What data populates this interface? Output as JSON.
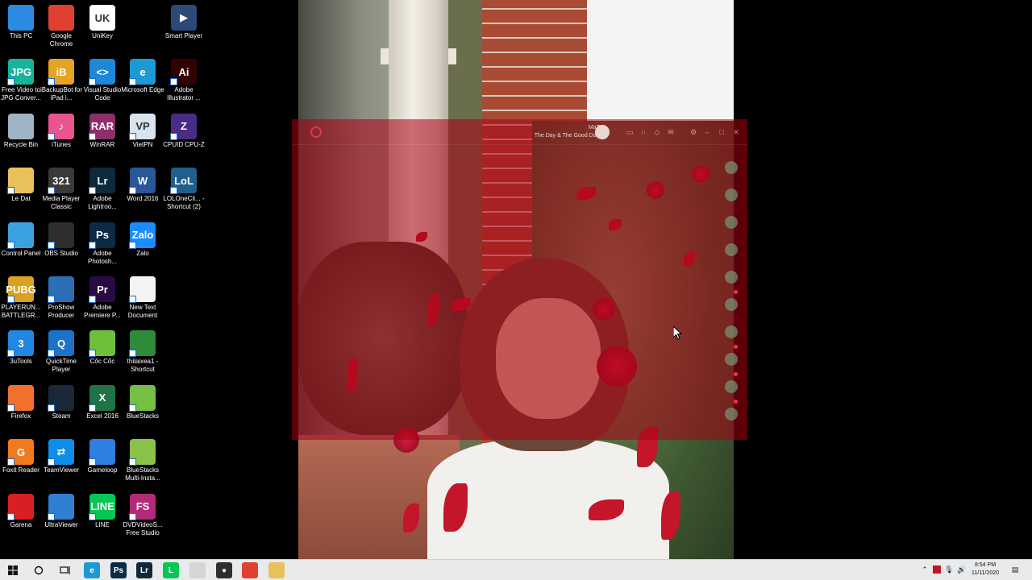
{
  "desktop_icons": [
    {
      "id": "this-pc",
      "label": "This PC",
      "glyph": "",
      "color": "#2a8be0",
      "icon": "computer-icon"
    },
    {
      "id": "chrome",
      "label": "Google Chrome",
      "glyph": "",
      "color": "#e0412f",
      "icon": "chrome-icon"
    },
    {
      "id": "unikey",
      "label": "UniKey",
      "glyph": "UK",
      "color": "#ffffff",
      "icon": "unikey-icon"
    },
    {
      "id": "smart-player",
      "label": "Smart Player",
      "glyph": "▶",
      "color": "#2c4a78",
      "icon": "player-icon"
    },
    {
      "id": "free-video",
      "label": "Free Video to JPG Conver...",
      "glyph": "JPG",
      "color": "#18b39a",
      "icon": "video-converter-icon"
    },
    {
      "id": "ibackupbot",
      "label": "iBackupBot for iPad i...",
      "glyph": "iB",
      "color": "#e5a421",
      "icon": "backup-icon"
    },
    {
      "id": "vscode",
      "label": "Visual Studio Code",
      "glyph": "<>",
      "color": "#1e88d8",
      "icon": "vscode-icon"
    },
    {
      "id": "edge",
      "label": "Microsoft Edge",
      "glyph": "e",
      "color": "#1b9ad6",
      "icon": "edge-icon"
    },
    {
      "id": "illustrator",
      "label": "Adobe Illustrator ...",
      "glyph": "Ai",
      "color": "#330000",
      "icon": "illustrator-icon"
    },
    {
      "id": "recycle",
      "label": "Recycle Bin",
      "glyph": "",
      "color": "#9fb3c4",
      "icon": "recycle-bin-icon"
    },
    {
      "id": "itunes",
      "label": "iTunes",
      "glyph": "♪",
      "color": "#e9548e",
      "icon": "itunes-icon"
    },
    {
      "id": "winrar",
      "label": "WinRAR",
      "glyph": "RAR",
      "color": "#8e2e6a",
      "icon": "winrar-icon"
    },
    {
      "id": "vietpn",
      "label": "VietPN",
      "glyph": "VP",
      "color": "#d9e4ee",
      "icon": "vpn-icon"
    },
    {
      "id": "cpuz",
      "label": "CPUID CPU-Z",
      "glyph": "Z",
      "color": "#4a2c87",
      "icon": "cpuz-icon"
    },
    {
      "id": "ledat",
      "label": "Le Dat",
      "glyph": "",
      "color": "#e8c15a",
      "icon": "folder-icon"
    },
    {
      "id": "mpc",
      "label": "Media Player Classic",
      "glyph": "321",
      "color": "#3a3a3a",
      "icon": "media-player-icon"
    },
    {
      "id": "lightroom",
      "label": "Adobe Lightroo...",
      "glyph": "Lr",
      "color": "#0c2a3c",
      "icon": "lightroom-icon"
    },
    {
      "id": "word",
      "label": "Word 2016",
      "glyph": "W",
      "color": "#2b579a",
      "icon": "word-icon"
    },
    {
      "id": "lolone",
      "label": "LOLOneCli... - Shortcut (2)",
      "glyph": "LoL",
      "color": "#1f5f8c",
      "icon": "lol-icon"
    },
    {
      "id": "control-panel",
      "label": "Control Panel",
      "glyph": "",
      "color": "#3ba2e0",
      "icon": "control-panel-icon"
    },
    {
      "id": "obs",
      "label": "OBS Studio",
      "glyph": "",
      "color": "#2e2e2e",
      "icon": "obs-icon"
    },
    {
      "id": "photoshop",
      "label": "Adobe Photosh...",
      "glyph": "Ps",
      "color": "#0b2a45",
      "icon": "photoshop-icon"
    },
    {
      "id": "zalo",
      "label": "Zalo",
      "glyph": "Zalo",
      "color": "#1a8cff",
      "icon": "zalo-icon"
    },
    {
      "id": "pubg",
      "label": "PLAYERUN... BATTLEGR...",
      "glyph": "PUBG",
      "color": "#d9a321",
      "icon": "pubg-icon"
    },
    {
      "id": "proshow",
      "label": "ProShow Producer",
      "glyph": "",
      "color": "#2b6fb6",
      "icon": "proshow-icon"
    },
    {
      "id": "premiere",
      "label": "Adobe Premiere P...",
      "glyph": "Pr",
      "color": "#2a0a45",
      "icon": "premiere-icon"
    },
    {
      "id": "new-text",
      "label": "New Text Document",
      "glyph": "",
      "color": "#f4f4f4",
      "icon": "text-document-icon"
    },
    {
      "id": "3utools",
      "label": "3uTools",
      "glyph": "3",
      "color": "#2088e0",
      "icon": "3utools-icon"
    },
    {
      "id": "quicktime",
      "label": "QuickTime Player",
      "glyph": "Q",
      "color": "#1a73c8",
      "icon": "quicktime-icon"
    },
    {
      "id": "coccoc",
      "label": "Cốc Cốc",
      "glyph": "",
      "color": "#6fbf3a",
      "icon": "coccoc-icon"
    },
    {
      "id": "thilaixe",
      "label": "thilaixea1 - Shortcut",
      "glyph": "",
      "color": "#2f8a3a",
      "icon": "traffic-light-icon"
    },
    {
      "id": "firefox",
      "label": "Firefox",
      "glyph": "",
      "color": "#f2702c",
      "icon": "firefox-icon"
    },
    {
      "id": "steam",
      "label": "Steam",
      "glyph": "",
      "color": "#1b2838",
      "icon": "steam-icon"
    },
    {
      "id": "excel",
      "label": "Excel 2016",
      "glyph": "X",
      "color": "#217346",
      "icon": "excel-icon"
    },
    {
      "id": "bluestacks",
      "label": "BlueStacks",
      "glyph": "",
      "color": "#75c043",
      "icon": "bluestacks-icon"
    },
    {
      "id": "foxit",
      "label": "Foxit Reader",
      "glyph": "G",
      "color": "#f07a1e",
      "icon": "foxit-icon"
    },
    {
      "id": "teamviewer",
      "label": "TeamViewer",
      "glyph": "⇄",
      "color": "#0e8ee9",
      "icon": "teamviewer-icon"
    },
    {
      "id": "gameloop",
      "label": "Gameloop",
      "glyph": "",
      "color": "#2f7fe0",
      "icon": "gameloop-icon"
    },
    {
      "id": "bluestacks-multi",
      "label": "BlueStacks Multi-Insta...",
      "glyph": "",
      "color": "#8bc34a",
      "icon": "bluestacks-multi-icon"
    },
    {
      "id": "garena",
      "label": "Garena",
      "glyph": "",
      "color": "#d81f26",
      "icon": "garena-icon"
    },
    {
      "id": "ultraviewer",
      "label": "UltraViewer",
      "glyph": "",
      "color": "#2f7fd3",
      "icon": "ultraviewer-icon"
    },
    {
      "id": "line",
      "label": "LINE",
      "glyph": "LINE",
      "color": "#06c755",
      "icon": "line-icon"
    },
    {
      "id": "dvdvideosoft",
      "label": "DVDVideoS... Free Studio",
      "glyph": "FS",
      "color": "#b42a7a",
      "icon": "dvdvideosoft-icon"
    }
  ],
  "app_window": {
    "user_name": "MaTa",
    "user_status": "The Day & The Good Day !"
  },
  "taskbar": {
    "apps": [
      {
        "name": "edge",
        "glyph": "e",
        "color": "#1b9ad6",
        "icon": "edge-icon"
      },
      {
        "name": "photoshop",
        "glyph": "Ps",
        "color": "#0b2a45",
        "icon": "photoshop-icon"
      },
      {
        "name": "lightroom",
        "glyph": "Lr",
        "color": "#0c2a3c",
        "icon": "lightroom-icon"
      },
      {
        "name": "line",
        "glyph": "L",
        "color": "#06c755",
        "icon": "line-icon"
      },
      {
        "name": "blank",
        "glyph": "",
        "color": "#d5d5d5",
        "icon": "app-icon"
      },
      {
        "name": "obs",
        "glyph": "●",
        "color": "#2e2e2e",
        "icon": "obs-icon"
      },
      {
        "name": "chrome",
        "glyph": "",
        "color": "#e0412f",
        "icon": "chrome-icon"
      },
      {
        "name": "explorer",
        "glyph": "",
        "color": "#e8c15a",
        "icon": "file-explorer-icon"
      }
    ],
    "time": "8:54 PM",
    "date": "11/11/2020"
  }
}
